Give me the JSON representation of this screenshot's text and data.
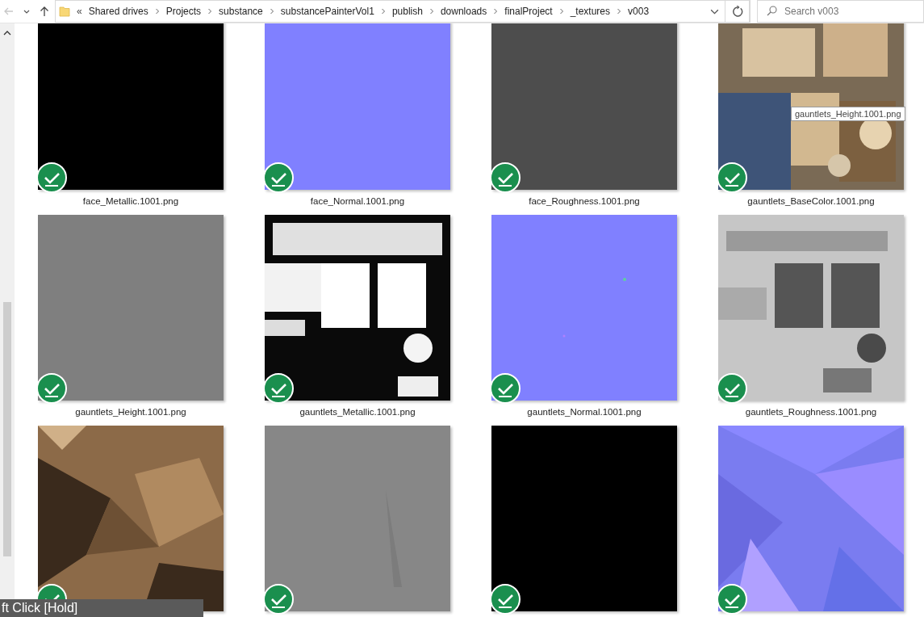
{
  "address_bar": {
    "overflow": "«",
    "crumbs": [
      "Shared drives",
      "Projects",
      "substance",
      "substancePainterVol1",
      "publish",
      "downloads",
      "finalProject",
      "_textures",
      "v003"
    ],
    "back_disabled": true
  },
  "search": {
    "placeholder": "Search v003"
  },
  "files": [
    {
      "name": "face_Metallic.1001.png",
      "synced": true
    },
    {
      "name": "face_Normal.1001.png",
      "synced": true
    },
    {
      "name": "face_Roughness.1001.png",
      "synced": true
    },
    {
      "name": "gauntlets_BaseColor.1001.png",
      "synced": true
    },
    {
      "name": "gauntlets_Height.1001.png",
      "synced": true
    },
    {
      "name": "gauntlets_Metallic.1001.png",
      "synced": true
    },
    {
      "name": "gauntlets_Normal.1001.png",
      "synced": true
    },
    {
      "name": "gauntlets_Roughness.1001.png",
      "synced": true
    },
    {
      "synced": true
    },
    {
      "synced": true
    },
    {
      "synced": true
    },
    {
      "synced": true
    }
  ],
  "tooltip": "gauntlets_Height.1001.png",
  "key_overlay": "ft Click [Hold]"
}
